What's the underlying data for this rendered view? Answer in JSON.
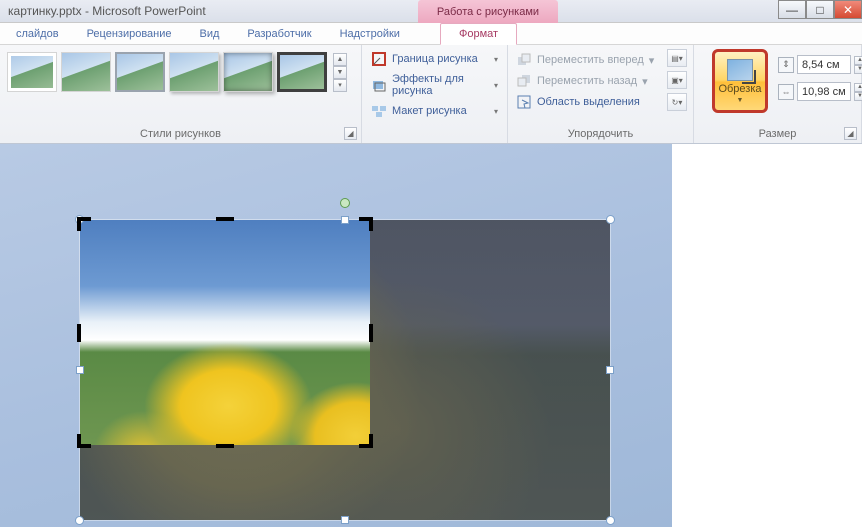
{
  "title": "картинку.pptx - Microsoft PowerPoint",
  "context_tab": "Работа с рисунками",
  "tabs": {
    "slides": "слайдов",
    "review": "Рецензирование",
    "view": "Вид",
    "developer": "Разработчик",
    "addins": "Надстройки",
    "format": "Формат"
  },
  "groups": {
    "styles": "Стили рисунков",
    "arrange": "Упорядочить",
    "size": "Размер"
  },
  "picfmt": {
    "border": "Граница рисунка",
    "effects": "Эффекты для рисунка",
    "layout": "Макет рисунка"
  },
  "arrange": {
    "bring_forward": "Переместить вперед",
    "send_backward": "Переместить назад",
    "selection_pane": "Область выделения"
  },
  "crop": {
    "label": "Обрезка"
  },
  "size": {
    "height": "8,54 см",
    "width": "10,98 см"
  },
  "win": {
    "min": "—",
    "max": "□",
    "close": "✕"
  }
}
